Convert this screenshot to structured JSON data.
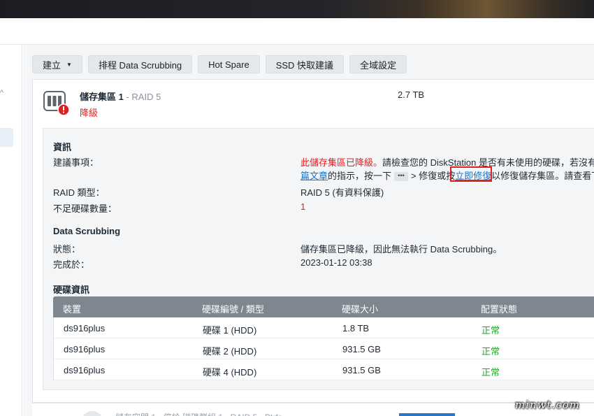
{
  "toolbar": {
    "create_label": "建立",
    "schedule_label": "排程 Data Scrubbing",
    "hot_spare_label": "Hot Spare",
    "ssd_label": "SSD 快取建議",
    "global_label": "全域設定"
  },
  "pool": {
    "name": "儲存集區 1",
    "raid_suffix": " - RAID 5",
    "status": "降級",
    "size": "2.7 TB"
  },
  "info": {
    "section_title": "資訊",
    "suggestion_label": "建議事項：",
    "suggestion_red": "此儲存集區已降級。",
    "suggestion_line1_rest": "請檢查您的 DiskStation 是否有未使用的硬碟，若沒有未",
    "suggestion_link1": "篇文章",
    "suggestion_line2_a": "的指示，按一下",
    "more_glyph": "•••",
    "suggestion_line2_b": "> 修復或按",
    "suggestion_link2": "立即修復",
    "suggestion_line2_c": "以修復儲存集區。請查看下方",
    "raid_type_label": "RAID 類型：",
    "raid_type_value": "RAID 5 (有資料保護)",
    "missing_label": "不足硬碟數量：",
    "missing_value": "1"
  },
  "scrubbing": {
    "section_title": "Data Scrubbing",
    "status_label": "狀態：",
    "status_value": "儲存集區已降級，因此無法執行 Data Scrubbing。",
    "completed_label": "完成於：",
    "completed_value": "2023-01-12 03:38"
  },
  "disks": {
    "section_title": "硬碟資訊",
    "headers": [
      "裝置",
      "硬碟編號 / 類型",
      "硬碟大小",
      "配置狀態"
    ],
    "rows": [
      [
        "ds916plus",
        "硬碟 1 (HDD)",
        "1.8 TB",
        "正常"
      ],
      [
        "ds916plus",
        "硬碟 2 (HDD)",
        "931.5 GB",
        "正常"
      ],
      [
        "ds916plus",
        "硬碟 4 (HDD)",
        "931.5 GB",
        "正常"
      ]
    ]
  },
  "next_pool": {
    "text": "儲存空間 1 - 停於 磁碟群組 1 - RAID 5 · Btrfs"
  },
  "watermark": "minwt.com",
  "colors": {
    "error": "#e02020",
    "ok": "#27a32b",
    "link": "#1a73c9",
    "table_header": "#7e878f"
  }
}
